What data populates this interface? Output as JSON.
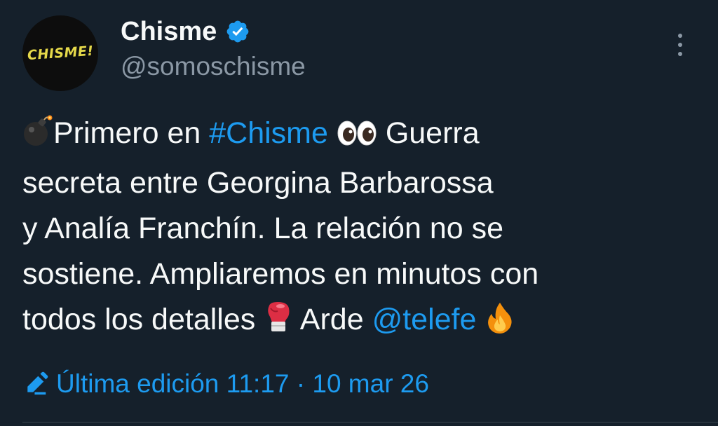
{
  "author": {
    "avatar_text": "CHISME!",
    "display_name": "Chisme",
    "handle": "@somoschisme"
  },
  "tweet": {
    "line1_pre": "Primero en ",
    "hashtag": "#Chisme",
    "line1_post": " Guerra",
    "line2": "secreta entre Georgina Barbarossa",
    "line3": "y Analía Franchín. La relación no se",
    "line4": "sostiene. Ampliaremos en minutos con",
    "line5_pre": "todos los detalles ",
    "line5_mid": " Arde ",
    "mention": "@telefe"
  },
  "edited": {
    "label": "Última edición 11:17 · 10 mar 26"
  },
  "icons": {
    "bomb": "bomb-emoji",
    "eyes": "eyes-emoji",
    "boxing_glove": "boxing-glove-emoji",
    "fire": "fire-emoji",
    "verified": "verified-badge-icon",
    "pencil": "pencil-icon",
    "more": "more-vertical-icon"
  },
  "colors": {
    "background": "#15202b",
    "text": "#f7f9f9",
    "secondary": "#8b98a5",
    "accent": "#1d9bf0",
    "divider": "#38444d"
  }
}
